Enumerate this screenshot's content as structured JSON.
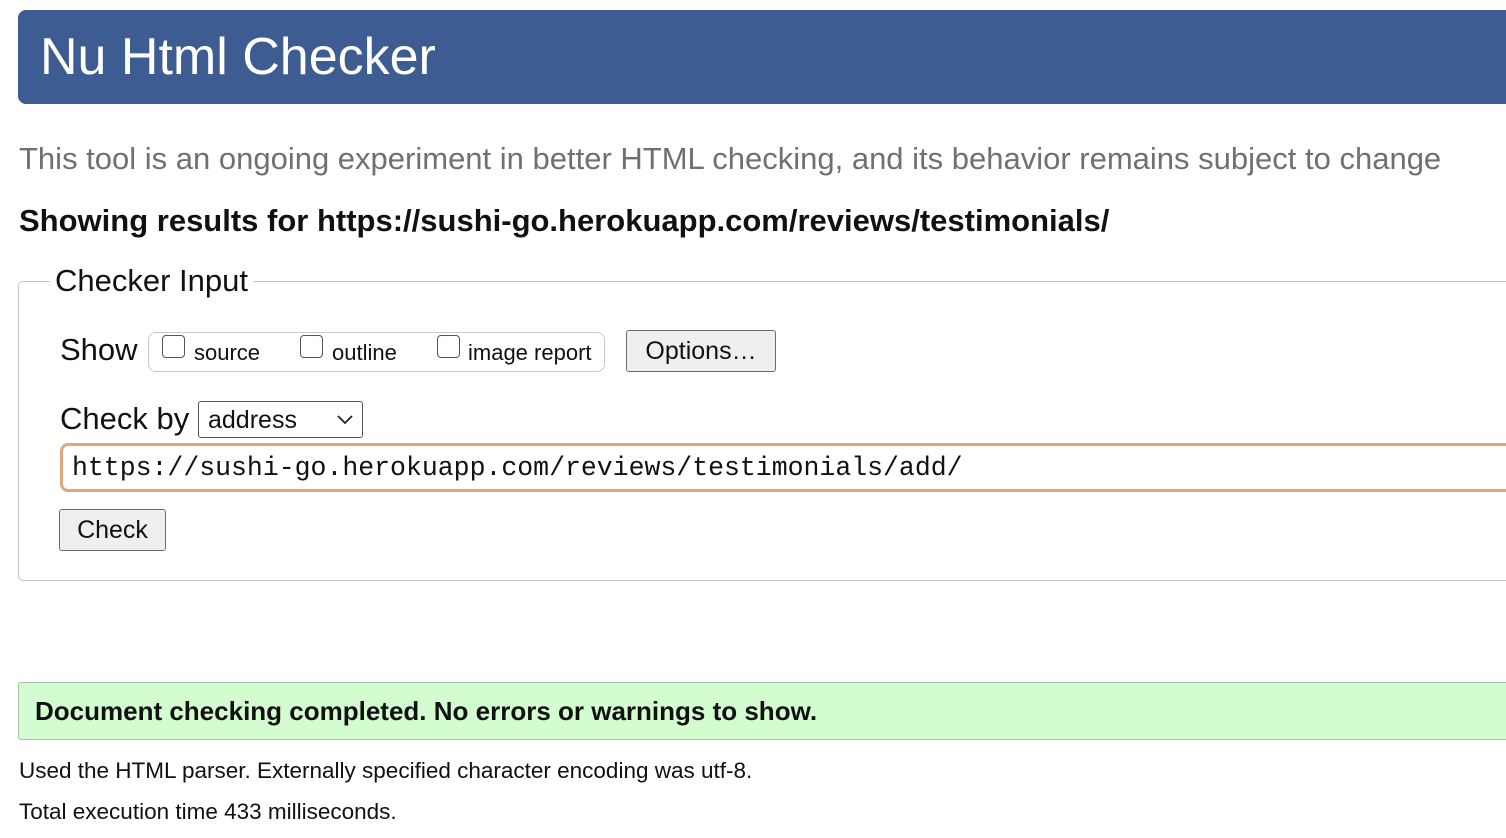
{
  "header": {
    "title": "Nu Html Checker"
  },
  "intro": "This tool is an ongoing experiment in better HTML checking, and its behavior remains subject to change",
  "results_heading": "Showing results for https://sushi-go.herokuapp.com/reviews/testimonials/",
  "checker_input": {
    "legend": "Checker Input",
    "show_label": "Show",
    "show_options": [
      {
        "label": "source",
        "checked": false
      },
      {
        "label": "outline",
        "checked": false
      },
      {
        "label": "image report",
        "checked": false
      }
    ],
    "options_button": "Options…",
    "check_by_label": "Check by",
    "check_by_value": "address",
    "url_value": "https://sushi-go.herokuapp.com/reviews/testimonials/add/",
    "check_button": "Check"
  },
  "result": {
    "success_message": "Document checking completed. No errors or warnings to show.",
    "parser_info": "Used the HTML parser. Externally specified character encoding was utf-8.",
    "execution_time": "Total execution time 433 milliseconds."
  },
  "colors": {
    "header_bg": "#3d5c91",
    "success_bg": "#d3fcd1",
    "input_focus_border": "#e0a878"
  }
}
